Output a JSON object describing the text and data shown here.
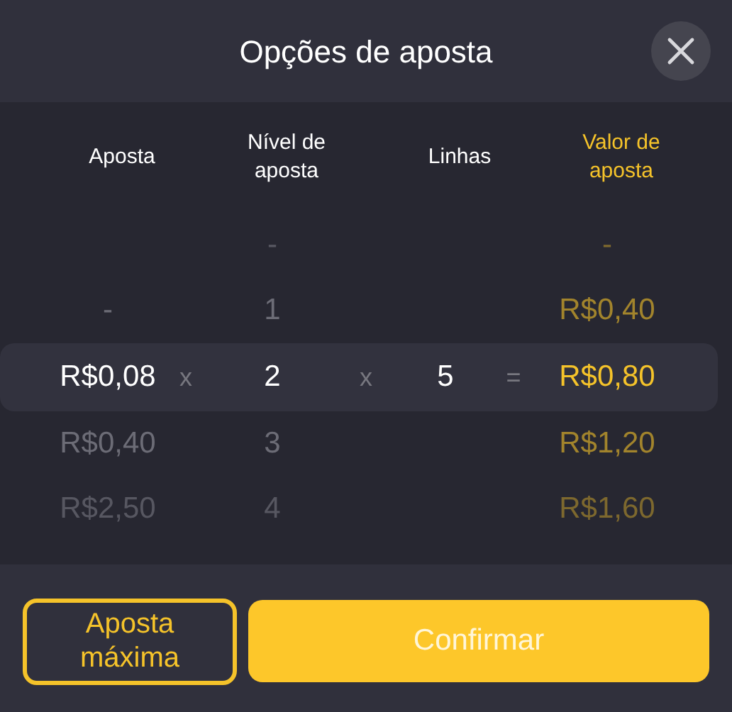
{
  "title": "Opções de aposta",
  "columns": [
    "Aposta",
    "Nível de aposta",
    "Linhas",
    "Valor de aposta"
  ],
  "operators": [
    "x",
    "x",
    "="
  ],
  "rows": [
    {
      "nivel": "-",
      "valor": "-",
      "selected": false
    },
    {
      "aposta": "-",
      "nivel": "1",
      "valor": "R$0,40",
      "selected": false
    },
    {
      "aposta": "R$0,08",
      "nivel": "2",
      "linhas": "5",
      "valor": "R$0,80",
      "selected": true
    },
    {
      "aposta": "R$0,40",
      "nivel": "3",
      "valor": "R$1,20",
      "selected": false
    },
    {
      "aposta": "R$2,50",
      "nivel": "4",
      "valor": "R$1,60",
      "selected": false
    }
  ],
  "buttons": {
    "max": "Aposta máxima",
    "confirm": "Confirmar"
  }
}
